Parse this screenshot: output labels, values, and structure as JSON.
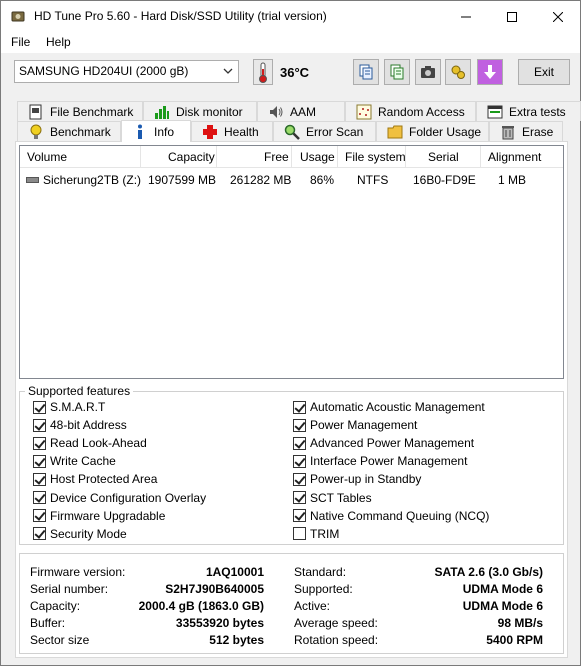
{
  "window": {
    "title": "HD Tune Pro 5.60 - Hard Disk/SSD Utility (trial version)"
  },
  "menu": {
    "file": "File",
    "help": "Help"
  },
  "toolbar": {
    "drive": "SAMSUNG HD204UI (2000 gB)",
    "temperature": "36°C",
    "exit_label": "Exit",
    "buttons": [
      "copy-text-icon",
      "copy-info-icon",
      "screenshot-icon",
      "options-icon",
      "save-icon"
    ]
  },
  "tabs": {
    "row1": [
      "File Benchmark",
      "Disk monitor",
      "AAM",
      "Random Access",
      "Extra tests"
    ],
    "row2": [
      "Benchmark",
      "Info",
      "Health",
      "Error Scan",
      "Folder Usage",
      "Erase"
    ],
    "active": "Info"
  },
  "volumes": {
    "headers": [
      "Volume",
      "Capacity",
      "Free",
      "Usage",
      "File system",
      "Serial",
      "Alignment"
    ],
    "rows": [
      {
        "volume": "Sicherung2TB (Z:)",
        "capacity": "1907599 MB",
        "free": "261282 MB",
        "usage": "86%",
        "fs": "NTFS",
        "serial": "16B0-FD9E",
        "alignment": "1 MB"
      }
    ]
  },
  "features": {
    "title": "Supported features",
    "left": [
      {
        "label": "S.M.A.R.T",
        "checked": true
      },
      {
        "label": "48-bit Address",
        "checked": true
      },
      {
        "label": "Read Look-Ahead",
        "checked": true
      },
      {
        "label": "Write Cache",
        "checked": true
      },
      {
        "label": "Host Protected Area",
        "checked": true
      },
      {
        "label": "Device Configuration Overlay",
        "checked": true
      },
      {
        "label": "Firmware Upgradable",
        "checked": true
      },
      {
        "label": "Security Mode",
        "checked": true
      }
    ],
    "right": [
      {
        "label": "Automatic Acoustic Management",
        "checked": true
      },
      {
        "label": "Power Management",
        "checked": true
      },
      {
        "label": "Advanced Power Management",
        "checked": true
      },
      {
        "label": "Interface Power Management",
        "checked": true
      },
      {
        "label": "Power-up in Standby",
        "checked": true
      },
      {
        "label": "SCT Tables",
        "checked": true
      },
      {
        "label": "Native Command Queuing (NCQ)",
        "checked": true
      },
      {
        "label": "TRIM",
        "checked": false
      }
    ]
  },
  "details": {
    "left": [
      {
        "label": "Firmware version:",
        "value": "1AQ10001"
      },
      {
        "label": "Serial number:",
        "value": "S2H7J90B640005"
      },
      {
        "label": "Capacity:",
        "value": "2000.4 gB (1863.0 GB)"
      },
      {
        "label": "Buffer:",
        "value": "33553920 bytes"
      },
      {
        "label": "Sector size",
        "value": "512 bytes"
      }
    ],
    "right": [
      {
        "label": "Standard:",
        "value": "SATA 2.6 (3.0 Gb/s)"
      },
      {
        "label": "Supported:",
        "value": "UDMA Mode 6"
      },
      {
        "label": "Active:",
        "value": "UDMA Mode 6"
      },
      {
        "label": "Average speed:",
        "value": "98 MB/s"
      },
      {
        "label": "Rotation speed:",
        "value": "5400 RPM"
      }
    ]
  }
}
